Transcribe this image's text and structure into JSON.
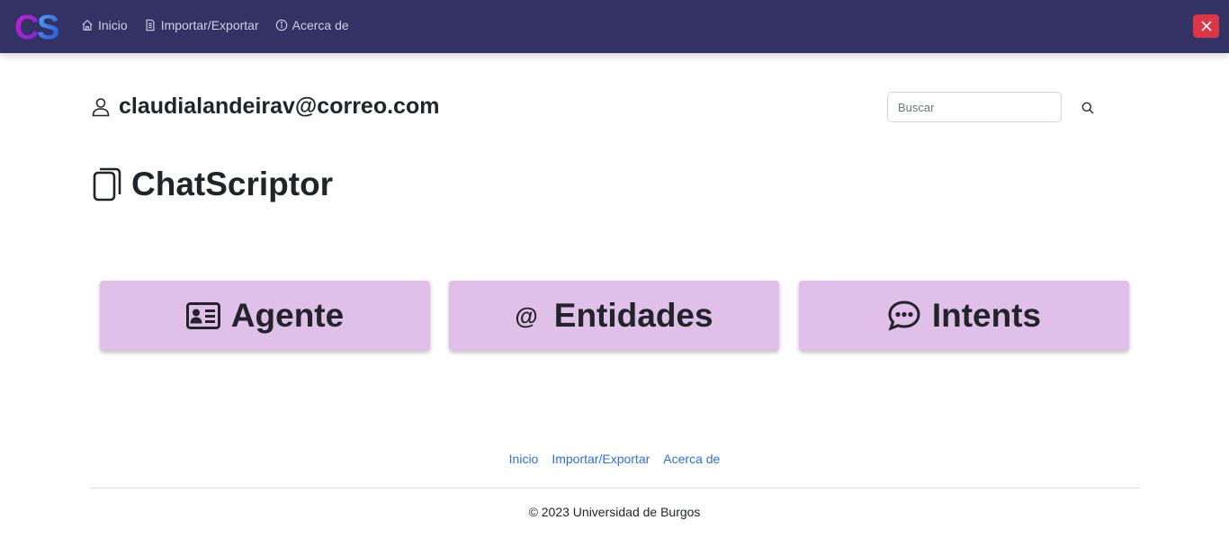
{
  "navbar": {
    "logo_text": "CS",
    "links": [
      {
        "label": "Inicio",
        "icon": "home-icon"
      },
      {
        "label": "Importar/Exportar",
        "icon": "file-icon"
      },
      {
        "label": "Acerca de",
        "icon": "info-icon"
      }
    ],
    "close_icon": "close-icon"
  },
  "user": {
    "email": "claudialandeirav@correo.com",
    "icon": "person-icon"
  },
  "search": {
    "placeholder": "Buscar",
    "icon": "search-icon"
  },
  "brand": {
    "title": "ChatScriptor",
    "icon": "files-icon"
  },
  "cards": [
    {
      "label": "Agente",
      "icon": "id-card-icon"
    },
    {
      "label": "Entidades",
      "icon": "at-icon",
      "symbol": "@"
    },
    {
      "label": "Intents",
      "icon": "chat-dots-icon"
    }
  ],
  "footer": {
    "links": [
      "Inicio",
      "Importar/Exportar",
      "Acerca de"
    ],
    "copyright": "© 2023 Universidad de Burgos"
  },
  "colors": {
    "navbar_bg": "#323264",
    "card_bg": "#e0bfe8",
    "close_button": "#dc3545",
    "link": "#2c6fd6"
  }
}
